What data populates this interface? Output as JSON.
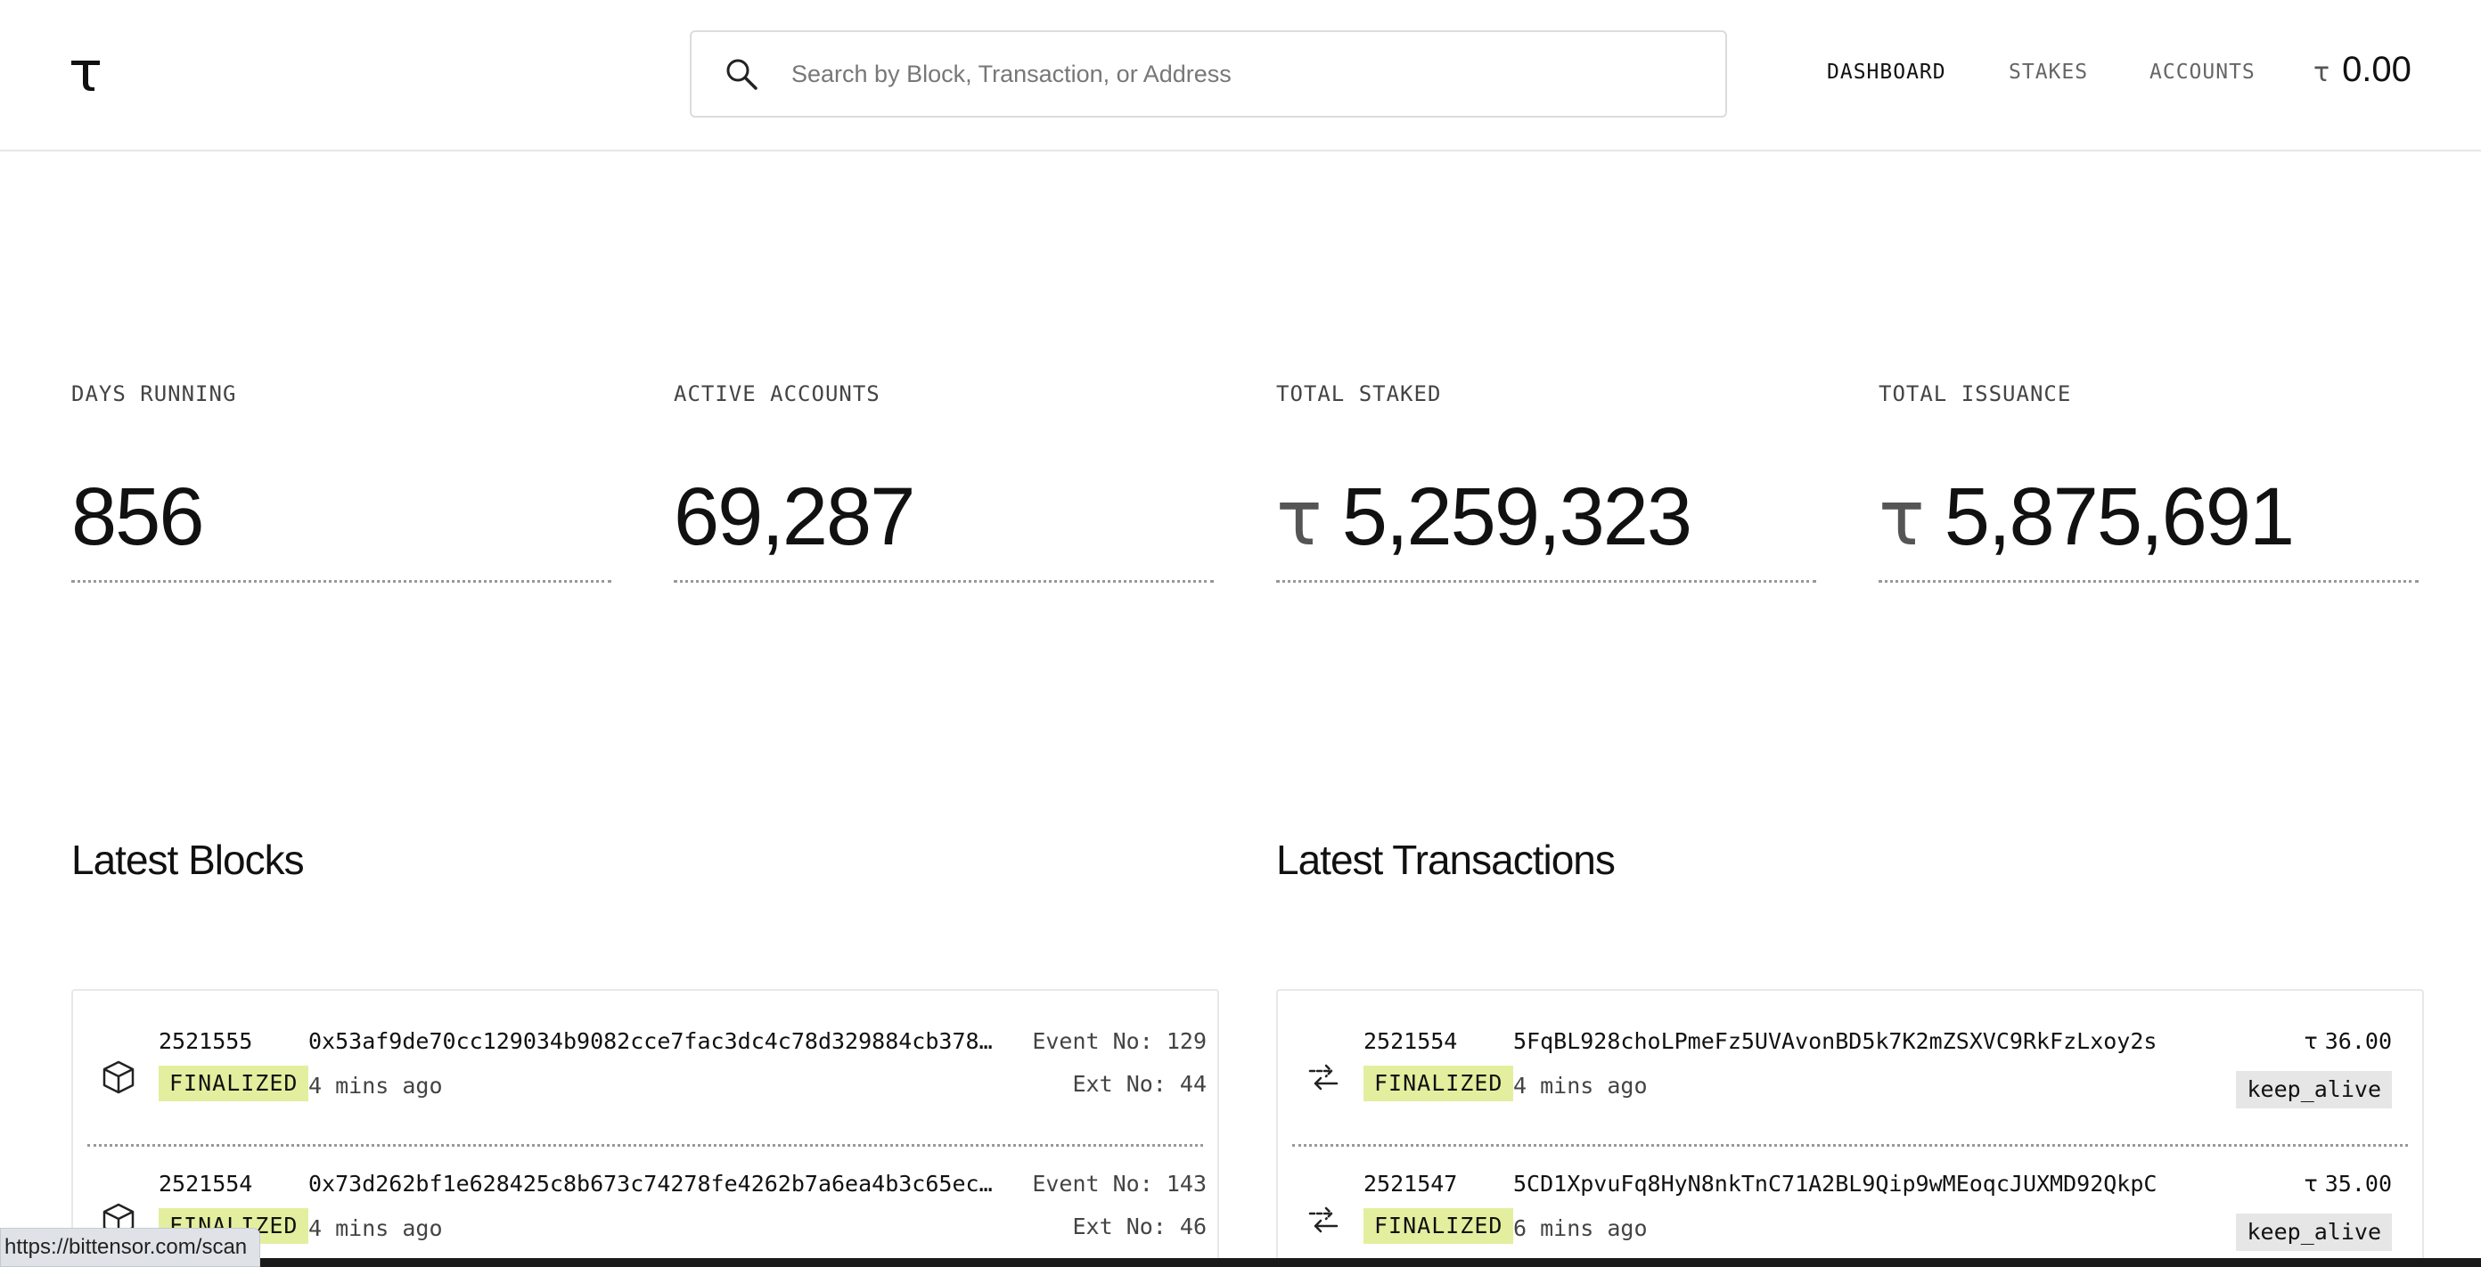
{
  "header": {
    "logo": "τ",
    "search_placeholder": "Search by Block, Transaction, or Address",
    "nav": [
      "DASHBOARD",
      "STAKES",
      "ACCOUNTS"
    ],
    "balance_symbol": "τ",
    "balance_value": "0.00"
  },
  "stats": [
    {
      "label": "DAYS RUNNING",
      "value": "856",
      "symbol": ""
    },
    {
      "label": "ACTIVE ACCOUNTS",
      "value": "69,287",
      "symbol": ""
    },
    {
      "label": "TOTAL STAKED",
      "value": "5,259,323",
      "symbol": "τ"
    },
    {
      "label": "TOTAL ISSUANCE",
      "value": "5,875,691",
      "symbol": "τ"
    }
  ],
  "latest_blocks": {
    "title": "Latest Blocks",
    "rows": [
      {
        "block": "2521555",
        "hash": "0x53af9de70cc129034b9082cce7fac3dc4c78d329884cb378…",
        "status": "FINALIZED",
        "ago": "4 mins ago",
        "event": "Event No: 129",
        "ext": "Ext No: 44"
      },
      {
        "block": "2521554",
        "hash": "0x73d262bf1e628425c8b673c74278fe4262b7a6ea4b3c65ec…",
        "status": "FINALIZED",
        "ago": "4 mins ago",
        "event": "Event No: 143",
        "ext": "Ext No: 46"
      }
    ]
  },
  "latest_transactions": {
    "title": "Latest Transactions",
    "rows": [
      {
        "block": "2521554",
        "address": "5FqBL928choLPmeFz5UVAvonBD5k7K2mZSXVC9RkFzLxoy2s",
        "status": "FINALIZED",
        "ago": "4 mins ago",
        "amount_symbol": "τ",
        "amount": "36.00",
        "method": "keep_alive"
      },
      {
        "block": "2521547",
        "address": "5CD1XpvuFq8HyN8nkTnC71A2BL9Qip9wMEoqcJUXMD92QkpC",
        "status": "FINALIZED",
        "ago": "6 mins ago",
        "amount_symbol": "τ",
        "amount": "35.00",
        "method": "keep_alive"
      }
    ]
  },
  "status_url": "https://bittensor.com/scan"
}
